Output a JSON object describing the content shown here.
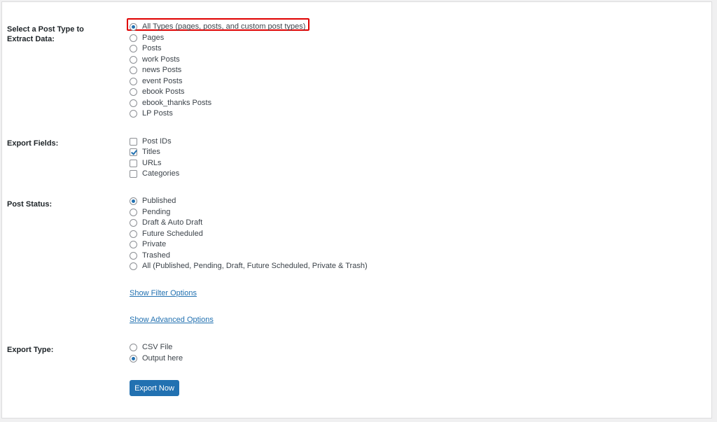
{
  "post_type": {
    "label": "Select a Post Type to Extract Data:",
    "options": [
      {
        "label": "All Types (pages, posts, and custom post types)",
        "checked": true
      },
      {
        "label": "Pages",
        "checked": false
      },
      {
        "label": "Posts",
        "checked": false
      },
      {
        "label": "work Posts",
        "checked": false
      },
      {
        "label": "news Posts",
        "checked": false
      },
      {
        "label": "event Posts",
        "checked": false
      },
      {
        "label": "ebook Posts",
        "checked": false
      },
      {
        "label": "ebook_thanks Posts",
        "checked": false
      },
      {
        "label": "LP Posts",
        "checked": false
      }
    ]
  },
  "export_fields": {
    "label": "Export Fields:",
    "options": [
      {
        "label": "Post IDs",
        "checked": false
      },
      {
        "label": "Titles",
        "checked": true
      },
      {
        "label": "URLs",
        "checked": false
      },
      {
        "label": "Categories",
        "checked": false
      }
    ]
  },
  "post_status": {
    "label": "Post Status:",
    "options": [
      {
        "label": "Published",
        "checked": true
      },
      {
        "label": "Pending",
        "checked": false
      },
      {
        "label": "Draft & Auto Draft",
        "checked": false
      },
      {
        "label": "Future Scheduled",
        "checked": false
      },
      {
        "label": "Private",
        "checked": false
      },
      {
        "label": "Trashed",
        "checked": false
      },
      {
        "label": "All (Published, Pending, Draft, Future Scheduled, Private & Trash)",
        "checked": false
      }
    ]
  },
  "links": {
    "filter": "Show Filter Options",
    "advanced": "Show Advanced Options"
  },
  "export_type": {
    "label": "Export Type:",
    "options": [
      {
        "label": "CSV File",
        "checked": false
      },
      {
        "label": "Output here",
        "checked": true
      }
    ]
  },
  "export_button": "Export Now",
  "colors": {
    "accent": "#2271b1",
    "highlight": "#e00000"
  }
}
